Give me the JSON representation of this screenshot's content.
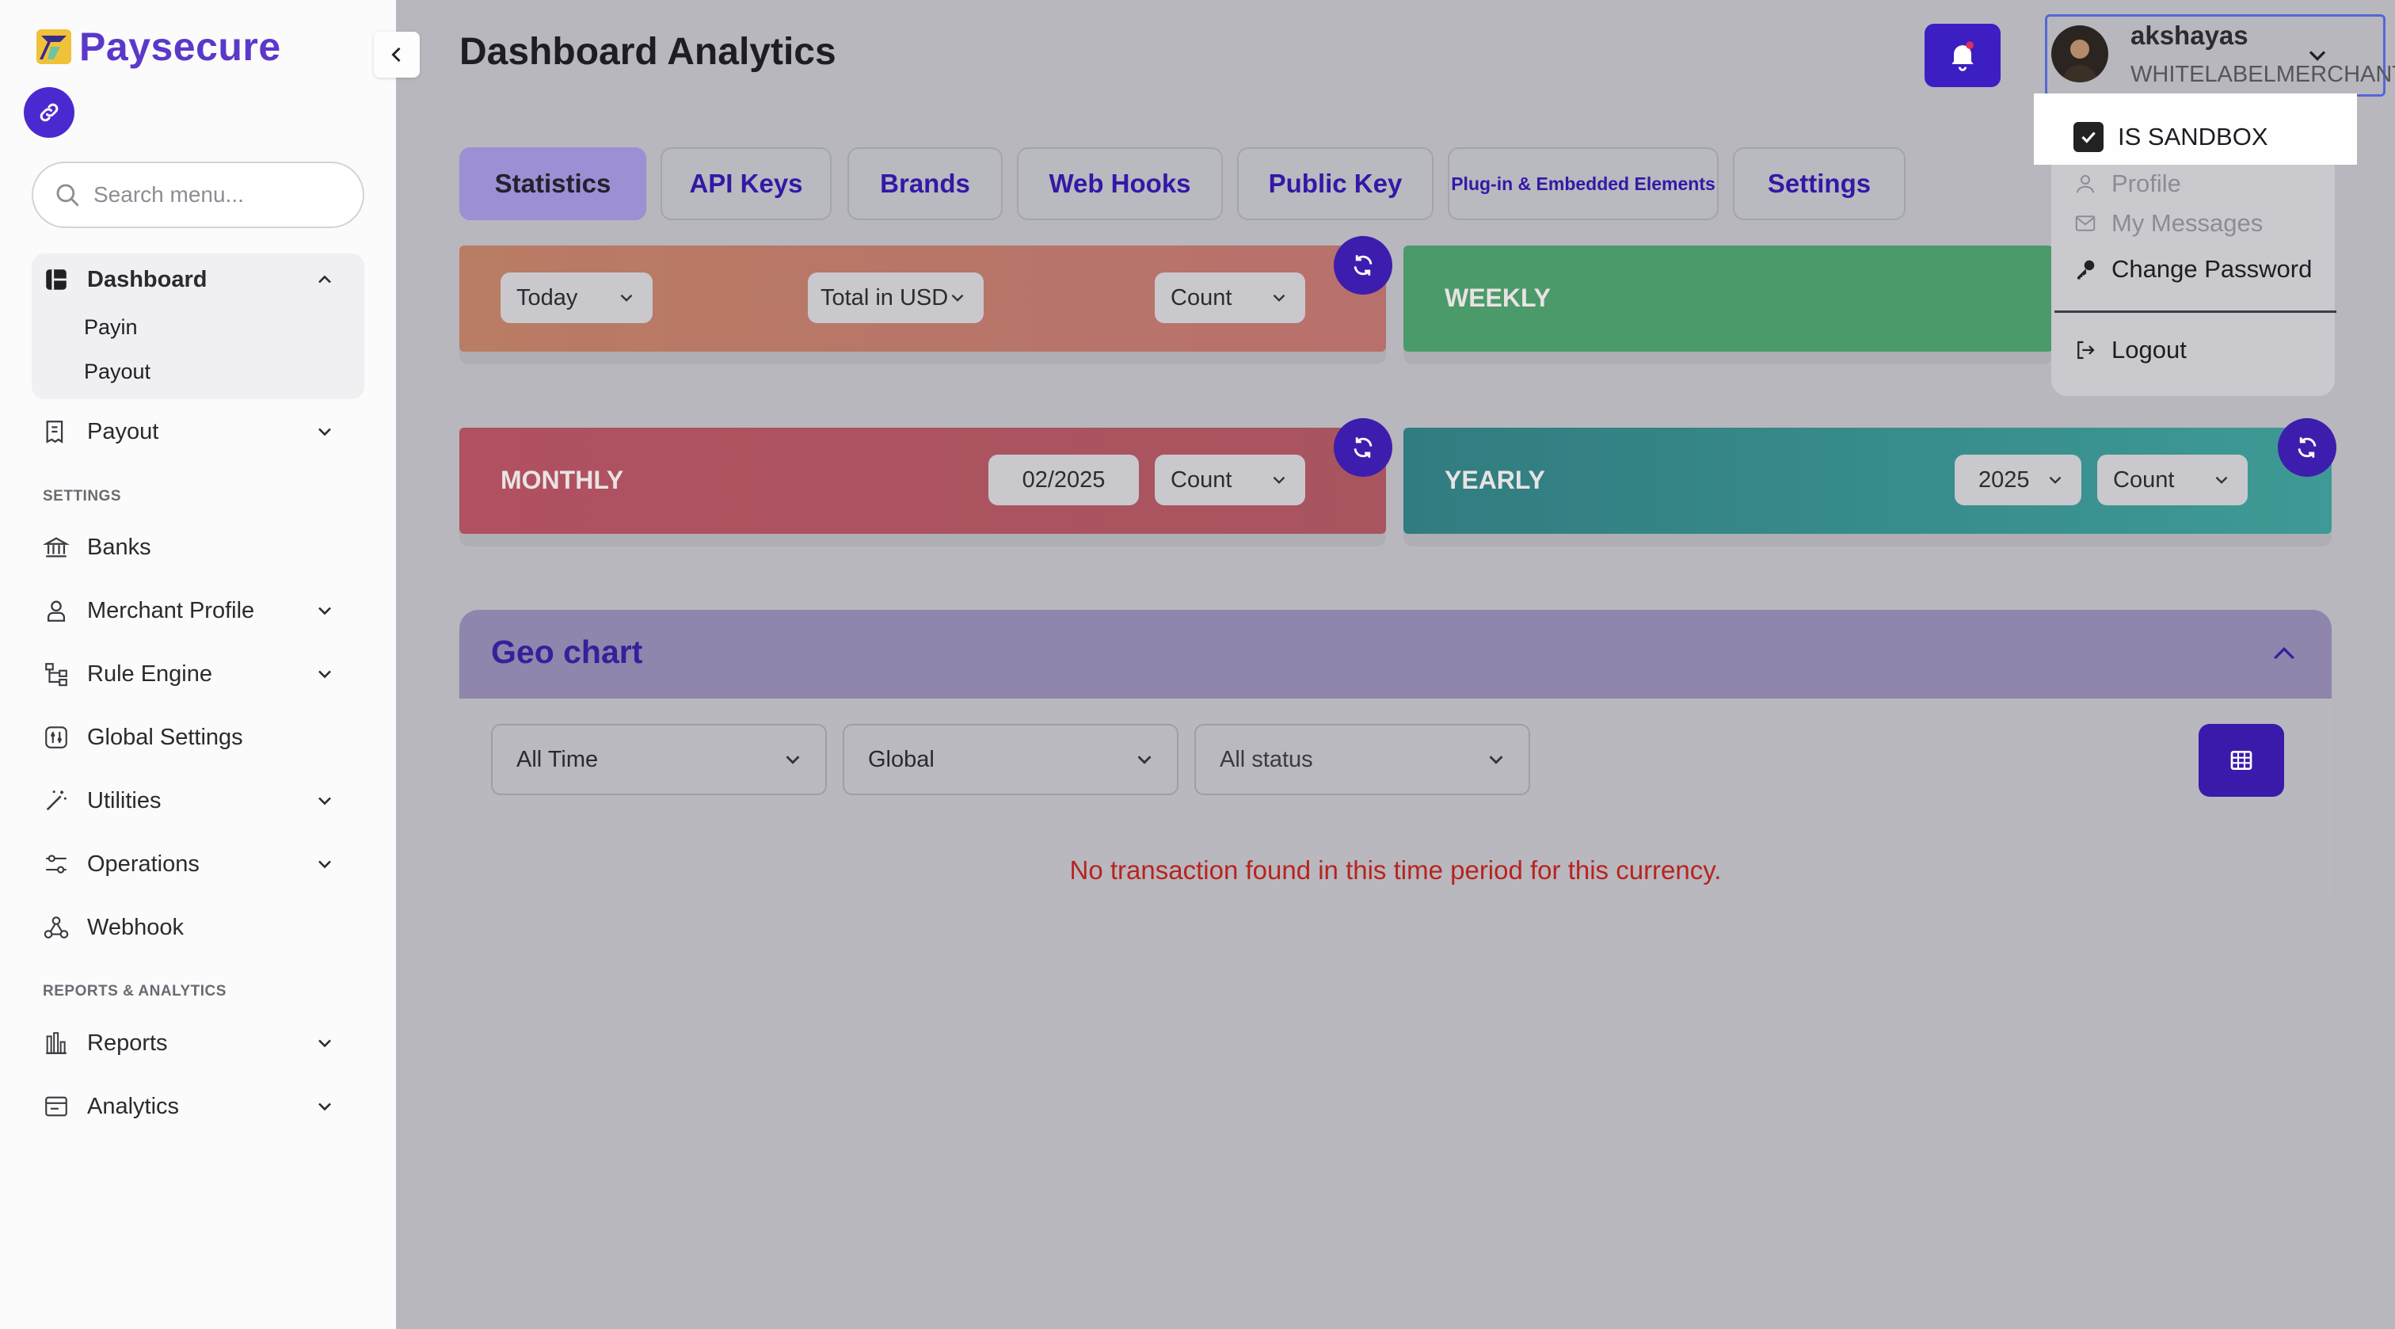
{
  "brand": {
    "name": "Paysecure",
    "accent": "#5b38c9"
  },
  "sidebar": {
    "search_placeholder": "Search menu...",
    "dashboard": {
      "label": "Dashboard",
      "children": [
        "Payin",
        "Payout"
      ]
    },
    "payout": "Payout",
    "settings_label": "SETTINGS",
    "settings_items": [
      "Banks",
      "Merchant Profile",
      "Rule Engine",
      "Global Settings",
      "Utilities",
      "Operations",
      "Webhook"
    ],
    "reports_label": "REPORTS & ANALYTICS",
    "reports_items": [
      "Reports",
      "Analytics"
    ]
  },
  "header": {
    "title": "Dashboard Analytics",
    "user": {
      "name": "akshayas",
      "role": "WHITELABELMERCHANT"
    }
  },
  "tabs": [
    "Statistics",
    "API Keys",
    "Brands",
    "Web Hooks",
    "Public Key",
    "Plug-in & Embedded Elements",
    "Settings"
  ],
  "cards": {
    "daily": {
      "period": "Today",
      "currency": "Total in USD",
      "metric": "Count"
    },
    "weekly": {
      "label": "WEEKLY"
    },
    "monthly": {
      "label": "MONTHLY",
      "date": "02/2025",
      "metric": "Count"
    },
    "yearly": {
      "label": "YEARLY",
      "year": "2025",
      "metric": "Count"
    }
  },
  "geo": {
    "title": "Geo chart",
    "filters": [
      "All Time",
      "Global",
      "All status"
    ],
    "message": "No transaction found in this time period for this currency."
  },
  "user_menu": {
    "sandbox": "IS SANDBOX",
    "items": [
      "Profile",
      "My Messages",
      "Change Password",
      "Logout"
    ]
  }
}
